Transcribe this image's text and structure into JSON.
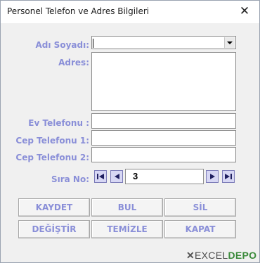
{
  "window": {
    "title": "Personel Telefon ve Adres Bilgileri"
  },
  "form": {
    "name_label": "Adı Soyadı:",
    "address_label": "Adres:",
    "home_phone_label": "Ev Telefonu :",
    "mobile1_label": "Cep Telefonu 1:",
    "mobile2_label": "Cep Telefonu 2:",
    "seq_label": "Sıra No:",
    "name_value": "",
    "address_value": "",
    "home_phone_value": "",
    "mobile1_value": "",
    "mobile2_value": "",
    "seq_value": "3"
  },
  "buttons": {
    "save": "KAYDET",
    "find": "BUL",
    "delete": "SİL",
    "update": "DEĞİŞTİR",
    "clear": "TEMİZLE",
    "close": "KAPAT"
  },
  "logo": {
    "part1": "EXCEL",
    "part2": "DEPO"
  },
  "colors": {
    "label": "#8a8fd8",
    "nav_button": "#d7d7f4",
    "window_bg": "#f0f0f0"
  },
  "icons": [
    "close-icon",
    "dropdown-arrow-icon",
    "first-record-icon",
    "previous-record-icon",
    "next-record-icon",
    "last-record-icon",
    "logo-x-icon"
  ]
}
